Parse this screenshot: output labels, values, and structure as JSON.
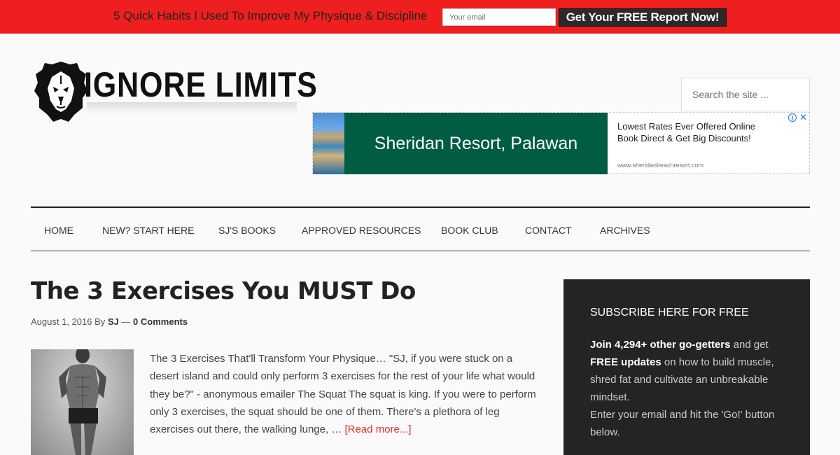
{
  "promo": {
    "text": "5 Quick Habits I Used To Improve My Physique & Discipline",
    "email_placeholder": "Your email",
    "button_label": "Get Your FREE Report Now!"
  },
  "header": {
    "logo_text": "IGNORE LIMITS",
    "search_placeholder": "Search the site ..."
  },
  "ad": {
    "banner_text": "Sheridan Resort, Palawan",
    "copy": "Lowest Rates Ever Offered Online Book Direct & Get Big Discounts!",
    "url": "www.sheridanbeachresort.com",
    "info_glyph": "i",
    "close_glyph": "✕"
  },
  "nav": {
    "items": [
      {
        "label": "Home"
      },
      {
        "label": "New? Start Here"
      },
      {
        "label": "SJ's Books"
      },
      {
        "label": "Approved Resources"
      },
      {
        "label": "Book Club"
      },
      {
        "label": "Contact"
      },
      {
        "label": "Archives"
      }
    ]
  },
  "post": {
    "title": "The 3 Exercises You MUST Do",
    "date": "August 1, 2016",
    "by": "By",
    "author": "SJ",
    "dash": "—",
    "comments": "0 Comments",
    "excerpt": "The 3 Exercises That'll Transform Your Physique… \"SJ, if you were stuck on a desert island and could only perform 3 exercises for the rest of your life what would they be?\" - anonymous emailer The Squat The squat is king. If you were to perform only 3 exercises, the squat should be one of them. There's a plethora of leg exercises out there, the walking lunge, …",
    "read_more": "[Read more...]"
  },
  "sidebar": {
    "title": "Subscribe here for free",
    "line1_bold": "Join 4,294+ other go-getters",
    "line1_rest": " and get ",
    "line2_bold": "FREE updates",
    "line2_rest": " on how to build muscle, shred fat and cultivate an unbreakable mindset.",
    "line3": "Enter your email and hit the 'Go!' button below."
  },
  "colors": {
    "promo_bar": "#f01f1f",
    "ad_banner": "#005c43",
    "sidebar_bg": "#242424",
    "read_more": "#e5302a"
  }
}
